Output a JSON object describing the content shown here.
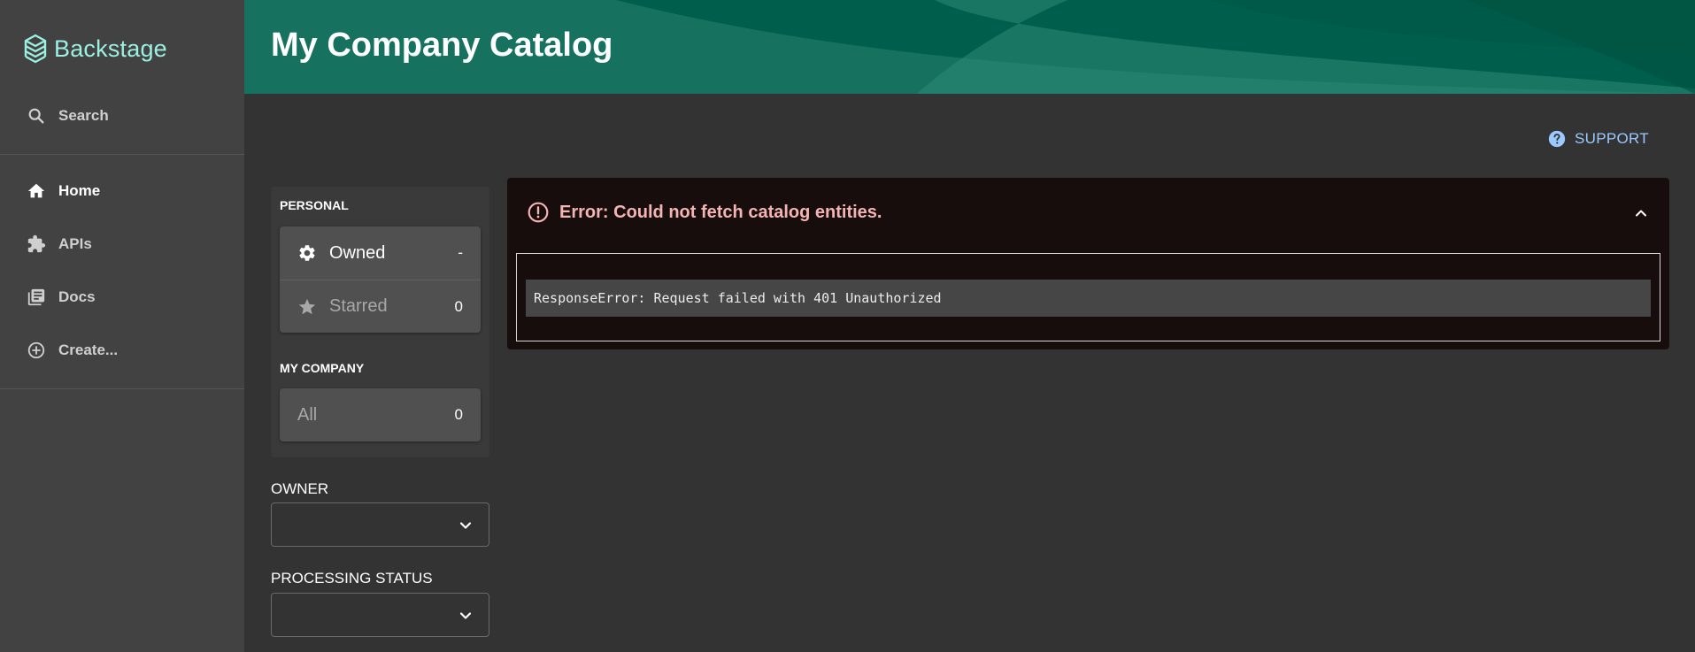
{
  "sidebar": {
    "logo_text": "Backstage",
    "search_label": "Search",
    "items": [
      {
        "label": "Home",
        "icon": "home-icon"
      },
      {
        "label": "APIs",
        "icon": "puzzle-icon"
      },
      {
        "label": "Docs",
        "icon": "docs-icon"
      },
      {
        "label": "Create...",
        "icon": "add-circle-icon"
      }
    ]
  },
  "header": {
    "title": "My Company Catalog"
  },
  "support": {
    "label": "SUPPORT",
    "icon": "help-circle-icon"
  },
  "filters": {
    "personal_heading": "PERSONAL",
    "personal": [
      {
        "label": "Owned",
        "count": "-",
        "icon": "gear-icon"
      },
      {
        "label": "Starred",
        "count": "0",
        "icon": "star-icon"
      }
    ],
    "company_heading": "MY COMPANY",
    "company": [
      {
        "label": "All",
        "count": "0"
      }
    ],
    "owner_label": "OWNER",
    "owner_value": "",
    "processing_status_label": "PROCESSING STATUS",
    "processing_status_value": ""
  },
  "error": {
    "title": "Error: Could not fetch catalog entities.",
    "message": "ResponseError: Request failed with 401 Unauthorized"
  },
  "colors": {
    "sidebar_bg": "#424242",
    "page_bg": "#333333",
    "logo_accent": "#9BF0E1",
    "header_bg": "#00604e",
    "support_link": "#9CC9FF",
    "error_text": "#f4b4b4",
    "error_bg": "#180d0d"
  }
}
